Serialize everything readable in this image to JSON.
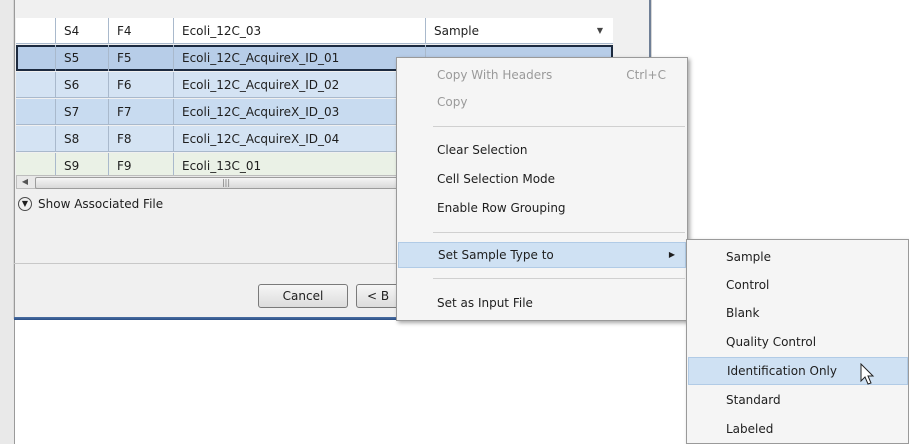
{
  "grid": {
    "rows": [
      {
        "c1": "S4",
        "c2": "F4",
        "name": "Ecoli_12C_03",
        "type": "Sample"
      },
      {
        "c1": "S5",
        "c2": "F5",
        "name": "Ecoli_12C_AcquireX_ID_01",
        "type": ""
      },
      {
        "c1": "S6",
        "c2": "F6",
        "name": "Ecoli_12C_AcquireX_ID_02",
        "type": ""
      },
      {
        "c1": "S7",
        "c2": "F7",
        "name": "Ecoli_12C_AcquireX_ID_03",
        "type": ""
      },
      {
        "c1": "S8",
        "c2": "F8",
        "name": "Ecoli_12C_AcquireX_ID_04",
        "type": ""
      },
      {
        "c1": "S9",
        "c2": "F9",
        "name": "Ecoli_13C_01",
        "type": ""
      }
    ]
  },
  "show_associated_file": "Show Associated File",
  "buttons": {
    "cancel": "Cancel",
    "back": "< B"
  },
  "context_menu": {
    "copy_with_headers": "Copy With Headers",
    "copy_shortcut": "Ctrl+C",
    "copy": "Copy",
    "clear_selection": "Clear Selection",
    "cell_selection_mode": "Cell Selection Mode",
    "enable_row_grouping": "Enable Row Grouping",
    "set_sample_type_to": "Set Sample Type to",
    "set_as_input_file": "Set as Input File"
  },
  "submenu": {
    "items": [
      "Sample",
      "Control",
      "Blank",
      "Quality Control",
      "Identification Only",
      "Standard",
      "Labeled"
    ],
    "highlighted": "Identification Only"
  },
  "icons": {
    "expand": "chevron-down-circle-icon",
    "submenu_arrow": "triangle-right-icon",
    "cursor": "mouse-pointer-icon"
  },
  "colors": {
    "selection": "#c8dbf0",
    "menu_highlight": "#cfe1f3",
    "window_border": "#2a4f86"
  }
}
